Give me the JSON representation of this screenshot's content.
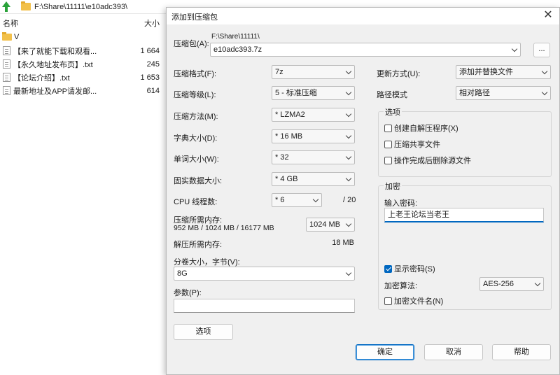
{
  "file_manager": {
    "address": "F:\\Share\\11111\\e10adc393\\",
    "columns": {
      "name": "名称",
      "size": "大小"
    },
    "rows": [
      {
        "name": "V",
        "size": "",
        "type": "folder"
      },
      {
        "name": "【来了就能下载和观看...",
        "size": "1 664",
        "type": "file"
      },
      {
        "name": "【永久地址发布页】.txt",
        "size": "245",
        "type": "file"
      },
      {
        "name": "【论坛介绍】.txt",
        "size": "1 653",
        "type": "file"
      },
      {
        "name": "最新地址及APP请发邮...",
        "size": "614",
        "type": "file"
      }
    ]
  },
  "dialog": {
    "title": "添加到压缩包",
    "close": "✕",
    "archive_label": "压缩包(A):",
    "archive_path": "F:\\Share\\11111\\",
    "archive_name": "e10adc393.7z",
    "browse_label": "...",
    "format_label": "压缩格式(F):",
    "format_value": "7z",
    "level_label": "压缩等级(L):",
    "level_value": "5 - 标准压缩",
    "method_label": "压缩方法(M):",
    "method_value": "*  LZMA2",
    "dict_label": "字典大小(D):",
    "dict_value": "*  16 MB",
    "word_label": "单词大小(W):",
    "word_value": "*  32",
    "solid_label": "固实数据大小:",
    "solid_value": "*  4 GB",
    "cpu_label": "CPU 线程数:",
    "cpu_value": "*  6",
    "cpu_total": "/ 20",
    "mem_comp_label": "压缩所需内存:",
    "mem_comp_detail": "952 MB / 1024 MB / 16177 MB",
    "mem_comp_value": "1024 MB",
    "mem_decomp_label": "解压所需内存:",
    "mem_decomp_value": "18 MB",
    "split_label": "分卷大小，字节(V):",
    "split_value": "8G",
    "params_label": "参数(P):",
    "params_value": "",
    "options_button": "选项",
    "update_label": "更新方式(U):",
    "update_value": "添加并替换文件",
    "path_label": "路径模式",
    "path_value": "相对路径",
    "options_group": "选项",
    "opt_sfx": "创建自解压程序(X)",
    "opt_shared": "压缩共享文件",
    "opt_delete": "操作完成后删除源文件",
    "encrypt_group": "加密",
    "password_label": "输入密码:",
    "password_value": "上老王论坛当老王",
    "show_password": "显示密码(S)",
    "algo_label": "加密算法:",
    "algo_value": "AES-256",
    "encrypt_names": "加密文件名(N)",
    "ok": "确定",
    "cancel": "取消",
    "help": "帮助"
  },
  "colors": {
    "accent": "#0067c0",
    "dialog_bg": "#f0f0f0",
    "folder": "#f2c04a",
    "up_arrow": "#2aa23a"
  }
}
